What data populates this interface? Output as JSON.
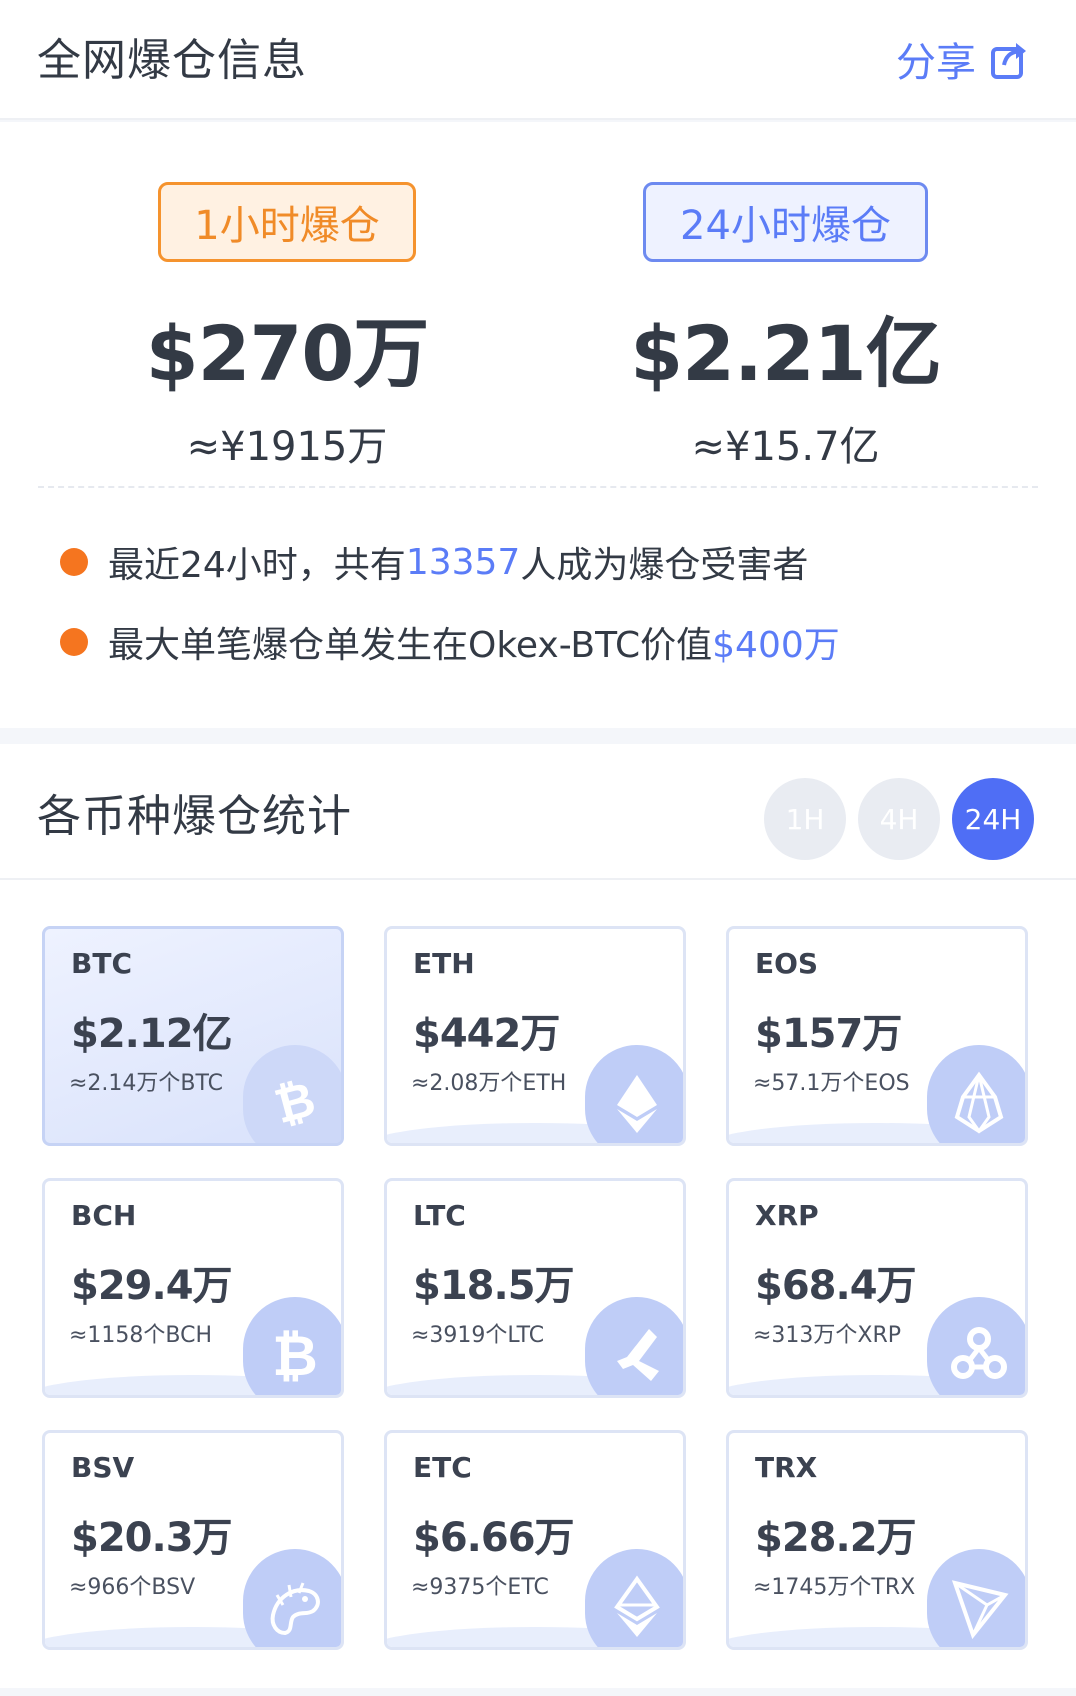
{
  "header": {
    "title": "全网爆仓信息",
    "share_label": "分享"
  },
  "summary": {
    "periods": [
      {
        "tag": "1小时爆仓",
        "usd": "$270万",
        "cny": "≈¥1915万"
      },
      {
        "tag": "24小时爆仓",
        "usd": "$2.21亿",
        "cny": "≈¥15.7亿"
      }
    ],
    "facts": [
      {
        "pre": "最近24小时，共有",
        "hl": "13357",
        "post": "人成为爆仓受害者"
      },
      {
        "pre": "最大单笔爆仓单发生在Okex-BTC价值",
        "hl": "$400万",
        "post": ""
      }
    ]
  },
  "stats": {
    "title": "各币种爆仓统计",
    "tabs": [
      {
        "label": "1H",
        "active": false
      },
      {
        "label": "4H",
        "active": false
      },
      {
        "label": "24H",
        "active": true
      }
    ],
    "coins": [
      {
        "symbol": "BTC",
        "amount": "$2.12亿",
        "qty": "≈2.14万个BTC",
        "icon": "bitcoin-icon"
      },
      {
        "symbol": "ETH",
        "amount": "$442万",
        "qty": "≈2.08万个ETH",
        "icon": "ethereum-icon"
      },
      {
        "symbol": "EOS",
        "amount": "$157万",
        "qty": "≈57.1万个EOS",
        "icon": "eos-icon"
      },
      {
        "symbol": "BCH",
        "amount": "$29.4万",
        "qty": "≈1158个BCH",
        "icon": "bitcoin-cash-icon"
      },
      {
        "symbol": "LTC",
        "amount": "$18.5万",
        "qty": "≈3919个LTC",
        "icon": "litecoin-icon"
      },
      {
        "symbol": "XRP",
        "amount": "$68.4万",
        "qty": "≈313万个XRP",
        "icon": "ripple-icon"
      },
      {
        "symbol": "BSV",
        "amount": "$20.3万",
        "qty": "≈966个BSV",
        "icon": "dragon-icon"
      },
      {
        "symbol": "ETC",
        "amount": "$6.66万",
        "qty": "≈9375个ETC",
        "icon": "ethereum-classic-icon"
      },
      {
        "symbol": "TRX",
        "amount": "$28.2万",
        "qty": "≈1745万个TRX",
        "icon": "tron-icon"
      }
    ]
  },
  "colors": {
    "accent": "#5b7cf7",
    "orange": "#f5932e",
    "dot": "#f5751f",
    "tab_active": "#4f6ef5"
  }
}
